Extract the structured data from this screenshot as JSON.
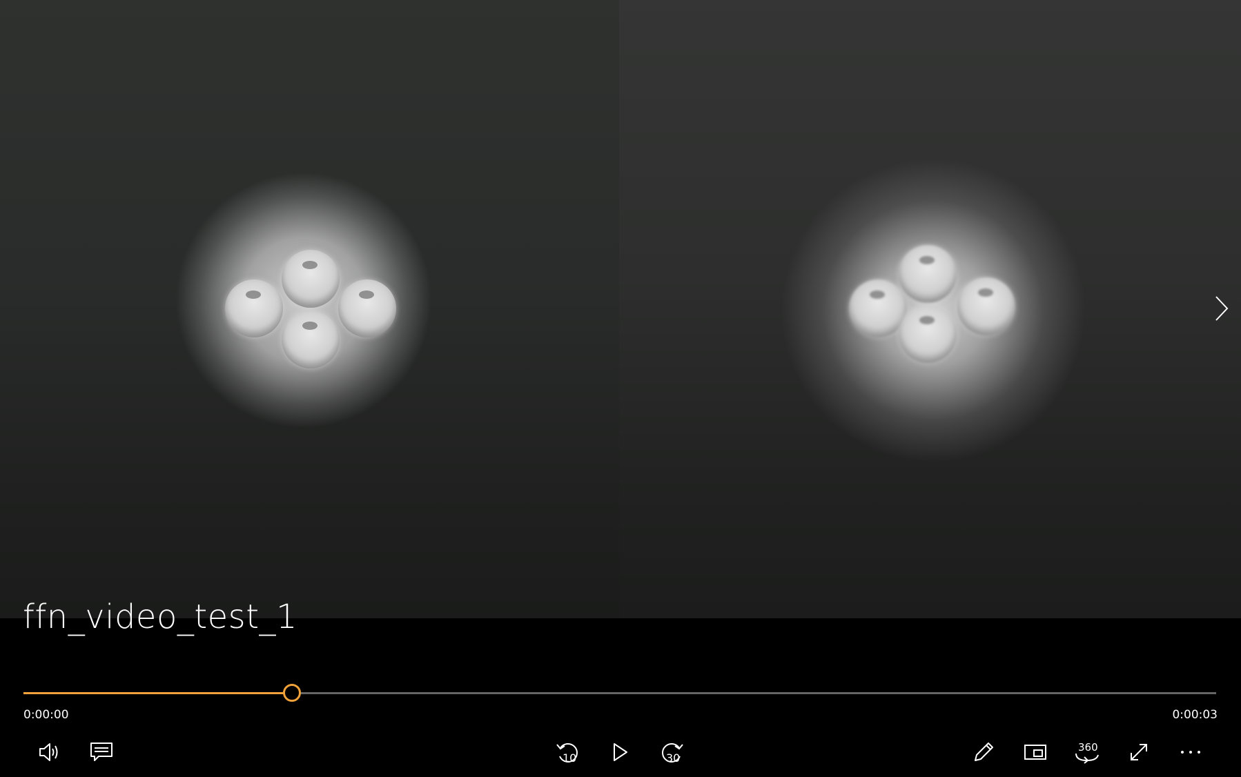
{
  "video": {
    "title": "ffn_video_test_1"
  },
  "playback": {
    "current_time": "0:00:00",
    "duration": "0:00:03",
    "progress_fraction": 0.225
  },
  "controls": {
    "skip_back_label": "10",
    "skip_forward_label": "30",
    "view_360_label": "360"
  },
  "colors": {
    "accent": "#f2a23a",
    "track": "#666666",
    "background": "#000000"
  },
  "icons": [
    "volume-icon",
    "captions-icon",
    "skip-back-10-icon",
    "play-icon",
    "skip-forward-30-icon",
    "edit-pencil-icon",
    "mini-view-icon",
    "view-360-icon",
    "fullscreen-icon",
    "more-options-icon",
    "next-arrow-icon"
  ]
}
